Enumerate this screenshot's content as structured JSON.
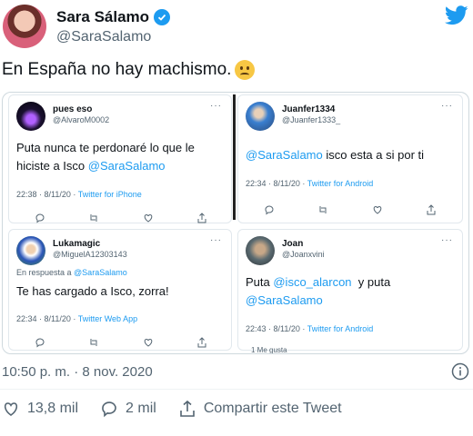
{
  "author": {
    "name": "Sara Sálamo",
    "handle": "@SaraSalamo"
  },
  "tweet_text": "En España no hay machismo.",
  "emoji": "slightly-frowning-face",
  "embedded": {
    "card_a": {
      "name": "pues eso",
      "handle": "@AlvaroM0002",
      "text_1": "Puta nunca te perdonaré lo que le",
      "text_2": "hiciste a Isco ",
      "mention": "@SaraSalamo",
      "time": "22:38 · 8/11/20 · ",
      "source": "Twitter for iPhone"
    },
    "card_b": {
      "name": "Juanfer1334",
      "handle": "@Juanfer1333_",
      "mention": "@SaraSalamo",
      "text_1": " isco esta a si por ti",
      "time": "22:34 · 8/11/20 · ",
      "source": "Twitter for Android"
    },
    "card_c": {
      "name": "Lukamagic",
      "handle": "@MiguelA12303143",
      "reply_prefix": "En respuesta a ",
      "reply_to": "@SaraSalamo",
      "text_1": "Te has cargado a Isco, zorra!",
      "time": "22:34 · 8/11/20 · ",
      "source": "Twitter Web App"
    },
    "card_d": {
      "name": "Joan",
      "handle": "@Joanxvini",
      "text_1": "Puta ",
      "mention_1": "@isco_alarcon",
      "text_2": "  y puta",
      "mention_2": "@SaraSalamo",
      "time": "22:43 · 8/11/20 · ",
      "source": "Twitter for Android",
      "likes": "1 Me gusta"
    }
  },
  "timestamp": "10:50 p. m. · 8 nov. 2020",
  "actions": {
    "likes": "13,8 mil",
    "replies": "2 mil",
    "share": "Compartir este Tweet"
  },
  "colors": {
    "accent": "#1d9bf0",
    "text": "#0f1419",
    "muted": "#536471"
  }
}
